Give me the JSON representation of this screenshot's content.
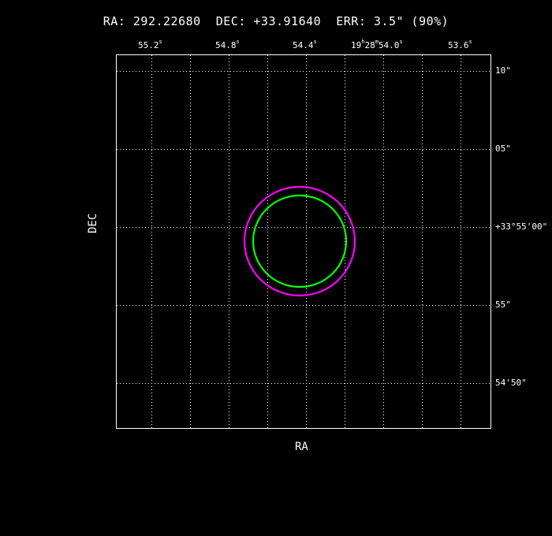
{
  "header": {
    "ra_label": "RA:",
    "ra_value": "292.22680",
    "dec_label": "DEC:",
    "dec_value": "+33.91640",
    "err_label": "ERR:",
    "err_value": "3.5\" (90%)"
  },
  "axes": {
    "xlabel": "RA",
    "ylabel": "DEC"
  },
  "top_ticks": [
    {
      "pre": "55.2",
      "unit": "s"
    },
    {
      "pre": "54.8",
      "unit": "s"
    },
    {
      "pre": "54.4",
      "unit": "s"
    },
    {
      "h": "19",
      "m": "28",
      "pre": "54.0",
      "unit": "s"
    },
    {
      "pre": "53.6",
      "unit": "s"
    }
  ],
  "right_ticks": [
    {
      "text": "10\""
    },
    {
      "text": "05\""
    },
    {
      "text": "+33°55'00\""
    },
    {
      "text": "55\""
    },
    {
      "text": "54'50\""
    }
  ],
  "circles": [
    {
      "name": "magenta-circle",
      "color": "#ff00ff"
    },
    {
      "name": "green-circle",
      "color": "#00ff00"
    }
  ],
  "colors": {
    "background": "#000000",
    "frame": "#ffffff",
    "grid": "#ffffff"
  }
}
